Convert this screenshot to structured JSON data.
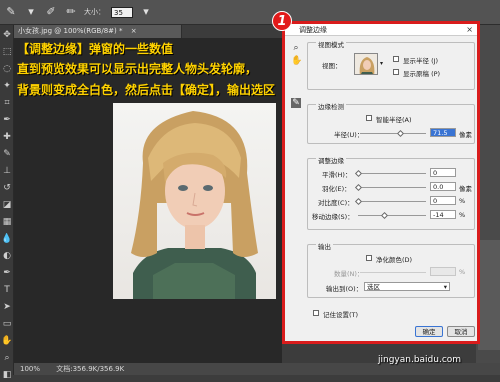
{
  "options_bar": {
    "size_label": "大小：",
    "size_value": "35"
  },
  "document": {
    "tab_title": "小女孩.jpg @ 100%(RGB/8#) *",
    "close_glyph": "×"
  },
  "annotation": {
    "line1": "【调整边缘】弹窗的一些数值",
    "line2": "直到预览效果可以显示出完整人物头发轮廓，",
    "line3": "背景则变成全白色，然后点击【确定】，输出选区"
  },
  "badge": {
    "number": "1"
  },
  "dialog": {
    "title": "调整边缘",
    "close": "×",
    "view_mode": {
      "title": "视图模式",
      "view_label": "视图：",
      "show_radius": "显示半径 (J)",
      "show_original": "显示原稿 (P)"
    },
    "edge_detection": {
      "title": "边缘检测",
      "smart_radius": "智能半径(A)",
      "radius_label": "半径(U)：",
      "radius_value": "71.5",
      "radius_unit": "像素"
    },
    "adjust_edge": {
      "title": "调整边缘",
      "smooth_label": "平滑(H)：",
      "smooth_value": "0",
      "feather_label": "羽化(E)：",
      "feather_value": "0.0",
      "feather_unit": "像素",
      "contrast_label": "对比度(C)：",
      "contrast_value": "0",
      "contrast_unit": "%",
      "shift_label": "移动边缘(S)：",
      "shift_value": "-14",
      "shift_unit": "%"
    },
    "output": {
      "title": "输出",
      "decontaminate": "净化颜色(D)",
      "amount_label": "数量(N)：",
      "amount_unit": "%",
      "output_to_label": "输出到(O)：",
      "output_to_value": "选区"
    },
    "remember": "记住设置(T)",
    "ok": "确定",
    "cancel": "取消"
  },
  "status_bar": {
    "zoom": "100%",
    "doc_info": "文档:356.9K/356.9K"
  },
  "watermark": "jingyan.baidu.com"
}
